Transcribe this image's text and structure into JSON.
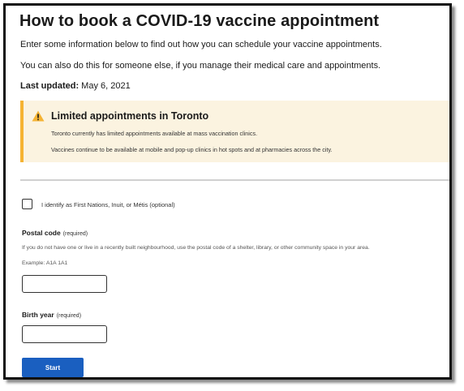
{
  "page": {
    "title": "How to book a COVID-19 vaccine appointment",
    "intro_1": "Enter some information below to find out how you can schedule your vaccine appointments.",
    "intro_2": "You can also do this for someone else, if you manage their medical care and appointments.",
    "updated_label": "Last updated:",
    "updated_date": " May 6, 2021"
  },
  "alert": {
    "icon": "warning-triangle-icon",
    "title": "Limited appointments in Toronto",
    "text_1": "Toronto currently has limited appointments available at mass vaccination clinics.",
    "text_2": "Vaccines continue to be available at mobile and pop-up clinics in hot spots and at pharmacies across the city.",
    "accent_color": "#f5b333",
    "background_color": "#fbf3e0"
  },
  "form": {
    "indigenous_checkbox_label": "I identify as First Nations, Inuit, or Métis (optional)",
    "indigenous_checked": false,
    "postal_label": "Postal code",
    "postal_required": "(required)",
    "postal_hint": "If you do not have one or live in a recently built neighbourhood, use the postal code of a shelter, library, or other community space in your area.",
    "postal_example": "Example: A1A 1A1",
    "postal_value": "",
    "birth_label": "Birth year",
    "birth_required": "(required)",
    "birth_value": "",
    "start_label": "Start",
    "button_color": "#1a5fc0"
  }
}
